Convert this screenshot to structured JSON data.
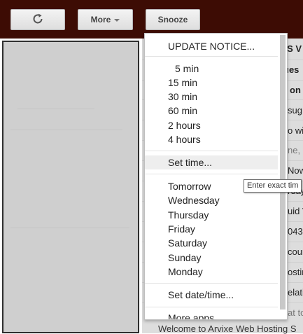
{
  "toolbar": {
    "more_label": "More",
    "snooze_label": "Snooze",
    "refresh_icon": "refresh-icon",
    "more_icon": "chevron-down-icon"
  },
  "email_list": {
    "rows": [
      {
        "text": "OS V",
        "style": "bold"
      },
      {
        "text": "ues",
        "style": "bold"
      },
      {
        "text": "on",
        "style": "bold"
      },
      {
        "text": "sug",
        "style": "normal"
      },
      {
        "text": "o wi",
        "style": "normal"
      },
      {
        "text": "ne, ",
        "style": "gray"
      },
      {
        "text": "Now",
        "style": "normal"
      },
      {
        "text": "rday",
        "style": "normal"
      },
      {
        "text": "uid V",
        "style": "normal"
      },
      {
        "text": "043",
        "style": "normal"
      },
      {
        "text": "cour",
        "style": "normal"
      },
      {
        "text": "ostin",
        "style": "normal"
      },
      {
        "text": "elati",
        "style": "normal"
      },
      {
        "text": "at to",
        "style": "gray"
      }
    ],
    "bottom_row": "Welcome to Arvixe Web Hosting S"
  },
  "snooze_menu": {
    "update_notice": "UPDATE NOTICE...",
    "durations": [
      "5 min",
      "15 min",
      "30 min",
      "60 min",
      "2 hours",
      "4 hours"
    ],
    "set_time": "Set time...",
    "days": [
      "Tomorrow",
      "Wednesday",
      "Thursday",
      "Friday",
      "Saturday",
      "Sunday",
      "Monday"
    ],
    "set_date_time": "Set date/time...",
    "more_apps": "More apps..."
  },
  "tooltip": {
    "text": "Enter exact tim"
  }
}
